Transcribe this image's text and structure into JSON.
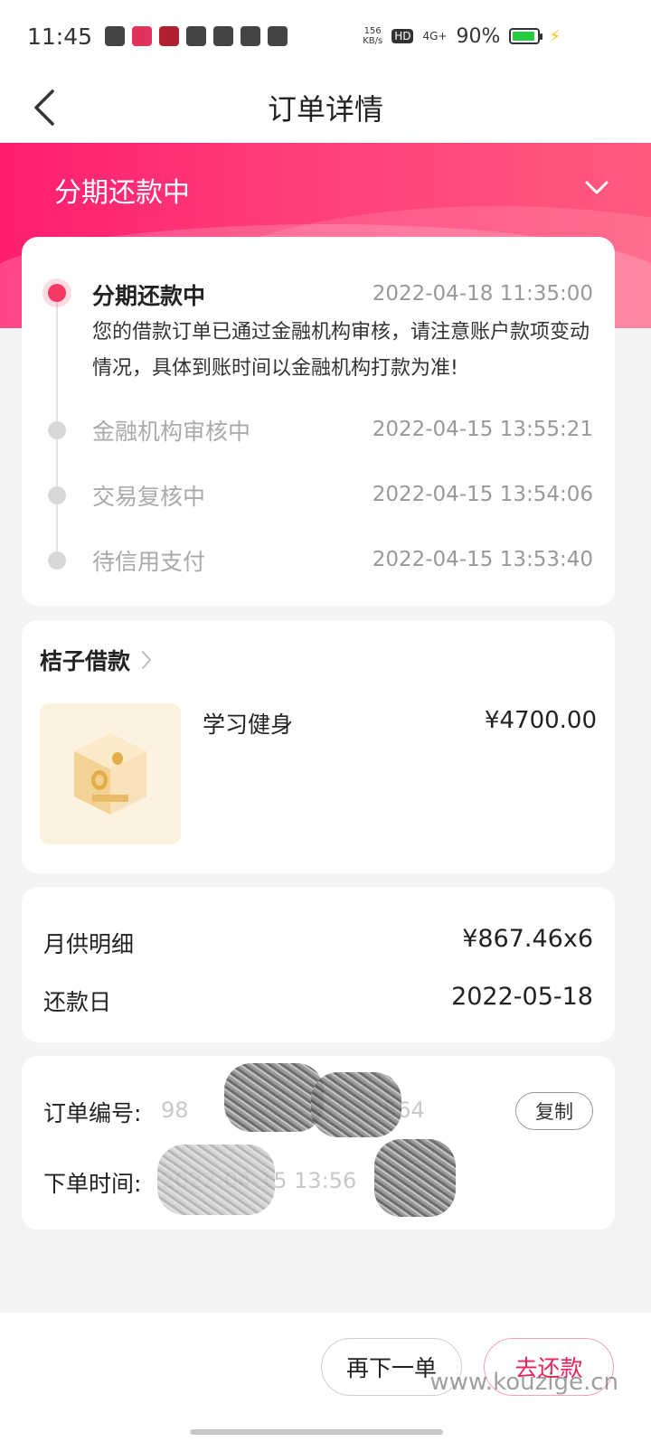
{
  "status_bar": {
    "time": "11:45",
    "net_speed": "156",
    "net_speed_unit": "KB/s",
    "hd": "HD",
    "network": "4G+",
    "battery": "90%",
    "battery_level": 0.9
  },
  "nav": {
    "title": "订单详情"
  },
  "hero": {
    "status": "分期还款中"
  },
  "timeline": [
    {
      "title": "分期还款中",
      "time": "2022-04-18 11:35:00",
      "desc": "您的借款订单已通过金融机构审核，请注意账户款项变动情况，具体到账时间以金融机构打款为准!"
    },
    {
      "title": "金融机构审核中",
      "time": "2022-04-15 13:55:21"
    },
    {
      "title": "交易复核中",
      "time": "2022-04-15 13:54:06"
    },
    {
      "title": "待信用支付",
      "time": "2022-04-15 13:53:40"
    }
  ],
  "product": {
    "merchant": "桔子借款",
    "name": "学习健身",
    "price": "¥4700.00"
  },
  "repayment": {
    "monthly_label": "月供明细",
    "monthly_value": "¥867.46x6",
    "due_label": "还款日",
    "due_value": "2022-05-18"
  },
  "order": {
    "number_label": "订单编号:",
    "number_prefix": "98",
    "number_suffix": "564",
    "copy_label": "复制",
    "time_label": "下单时间:",
    "time_partial": "2022-04-15 13:56"
  },
  "bottom": {
    "reorder_label": "再下一单",
    "repay_label": "去还款",
    "watermark": "www.kouzige.cn"
  },
  "colors": {
    "accent": "#f23a64",
    "hero_start": "#ff1d6f",
    "hero_end": "#ff5a7e"
  }
}
